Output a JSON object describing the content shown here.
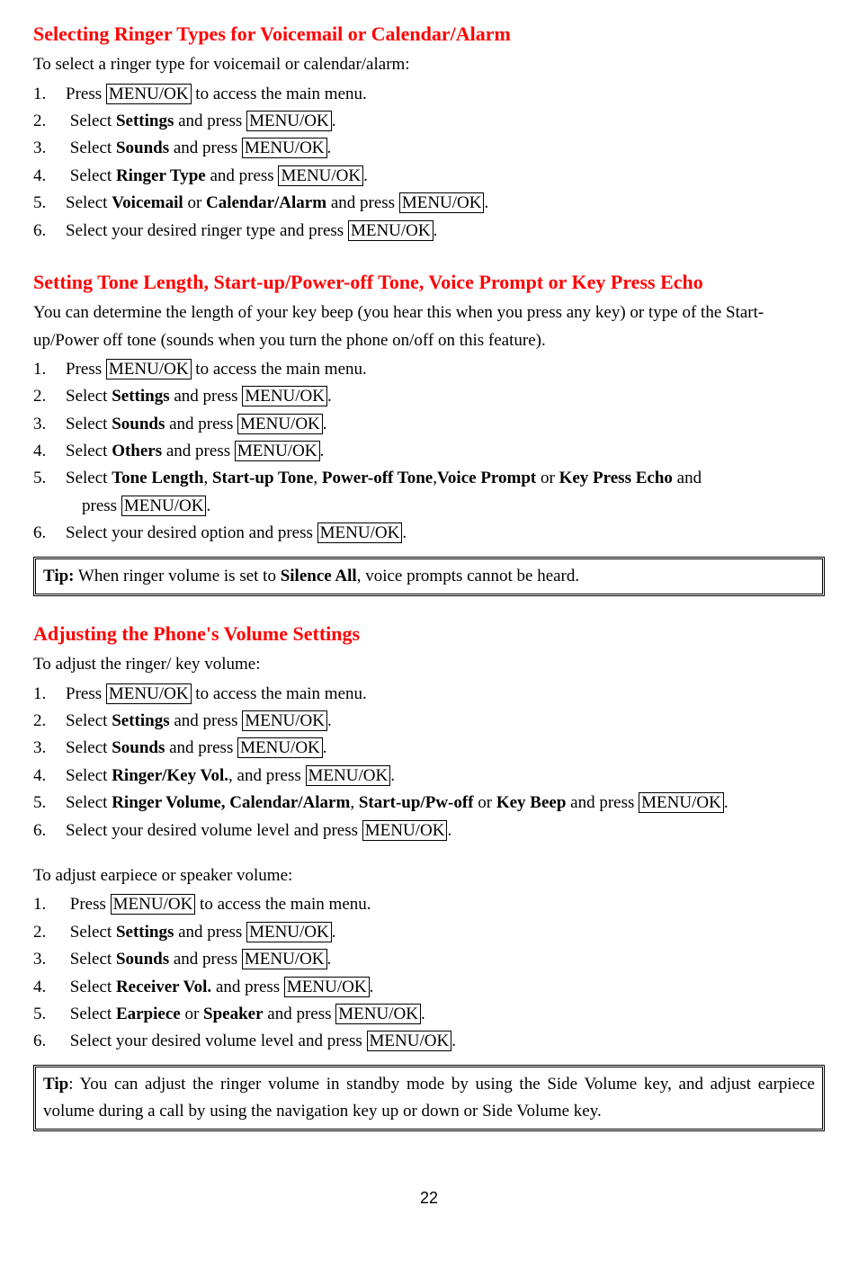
{
  "key": "MENU/OK",
  "sec1": {
    "heading": "Selecting Ringer Types for Voicemail or Calendar/Alarm",
    "intro": "To select a ringer type for voicemail or calendar/alarm:",
    "s1a": "1.",
    "s1b": "Press ",
    "s1c": " to access the main menu.",
    "s2a": "2.",
    "s2b": " Select ",
    "s2bold": "Settings",
    "s2c": " and press ",
    "s2d": ".",
    "s3a": "3.",
    "s3b": " Select ",
    "s3bold": "Sounds",
    "s3c": " and press ",
    "s3d": ".",
    "s4a": "4.",
    "s4b": " Select ",
    "s4bold": "Ringer Type",
    "s4c": " and press ",
    "s4d": ".",
    "s5a": "5.",
    "s5b": "Select ",
    "s5bold1": "Voicemail",
    "s5or": " or ",
    "s5bold2": "Calendar/Alarm",
    "s5c": " and press ",
    "s5d": ".",
    "s6a": "6.",
    "s6b": "Select your desired ringer type and press ",
    "s6c": "."
  },
  "sec2": {
    "heading": "Setting Tone Length, Start-up/Power-off Tone, Voice Prompt or Key Press Echo",
    "intro": "You can determine the length of your key beep (you hear this when you press any key) or type of the Start-up/Power off tone (sounds when you turn the phone on/off on this feature).",
    "s1a": "1.",
    "s1b": "Press ",
    "s1c": " to access the main menu.",
    "s2a": "2.",
    "s2b": "Select ",
    "s2bold": "Settings",
    "s2c": " and press ",
    "s2d": ".",
    "s3a": "3.",
    "s3b": "Select ",
    "s3bold": "Sounds",
    "s3c": " and press ",
    "s3d": ".",
    "s4a": "4.",
    "s4b": "Select ",
    "s4bold": "Others",
    "s4c": " and press ",
    "s4d": ".",
    "s5a": "5.",
    "s5b": "Select ",
    "s5b1": "Tone Length",
    "s5c1": ", ",
    "s5b2": "Start-up Tone",
    "s5c2": ", ",
    "s5b3": "Power-off Tone",
    "s5c3": ",",
    "s5b4": "Voice Prompt",
    "s5c4": " or ",
    "s5b5": "Key Press Echo",
    "s5c5": " and",
    "s5line2a": " press ",
    "s5line2b": ".",
    "s6a": "6.",
    "s6b": "Select your desired option and press ",
    "s6c": "."
  },
  "tip1": {
    "label": "Tip:",
    "text1": " When ringer volume is set to ",
    "bold": "Silence All",
    "text2": ", voice prompts cannot be heard."
  },
  "sec3": {
    "heading": "Adjusting the Phone's Volume Settings",
    "intro": "To adjust the ringer/ key volume:",
    "s1a": "1.",
    "s1b": "Press ",
    "s1c": " to access the main menu.",
    "s2a": "2.",
    "s2b": "Select ",
    "s2bold": "Settings",
    "s2c": " and press ",
    "s2d": ".",
    "s3a": "3.",
    "s3b": "Select ",
    "s3bold": "Sounds",
    "s3c": " and press ",
    "s3d": ".",
    "s4a": "4.",
    "s4b": "Select ",
    "s4bold": "Ringer/Key Vol.",
    "s4c": ", and press ",
    "s4d": ".",
    "s5a": "5.",
    "s5b": "Select ",
    "s5b1": "Ringer Volume, Calendar/Alarm",
    "s5c1": ", ",
    "s5b2": "Start-up/Pw-off",
    "s5c2": " or ",
    "s5b3": "Key Beep",
    "s5c3": " and press ",
    "s5d": ".",
    "s6a": "6.",
    "s6b": "Select your desired volume level and press ",
    "s6c": "."
  },
  "sec4": {
    "intro": "To adjust earpiece or speaker volume:",
    "s1a": "1.",
    "s1b": " Press ",
    "s1c": " to access the main menu.",
    "s2a": "2.",
    "s2b": " Select ",
    "s2bold": "Settings",
    "s2c": " and press ",
    "s2d": ".",
    "s3a": "3.",
    "s3b": " Select ",
    "s3bold": "Sounds",
    "s3c": " and press ",
    "s3d": ".",
    "s4a": "4.",
    "s4b": " Select ",
    "s4bold": "Receiver Vol.",
    "s4c": " and press ",
    "s4d": ".",
    "s5a": "5.",
    "s5b": " Select ",
    "s5bold1": "Earpiece",
    "s5or": " or ",
    "s5bold2": "Speaker",
    "s5c": " and press ",
    "s5d": ".",
    "s6a": "6.",
    "s6b": " Select your desired volume level and press ",
    "s6c": "."
  },
  "tip2": {
    "label": "Tip",
    "text": ": You can adjust the ringer volume in standby mode by using the Side Volume key, and adjust earpiece volume during a call by using the navigation key up or down or Side Volume key."
  },
  "page": "22"
}
